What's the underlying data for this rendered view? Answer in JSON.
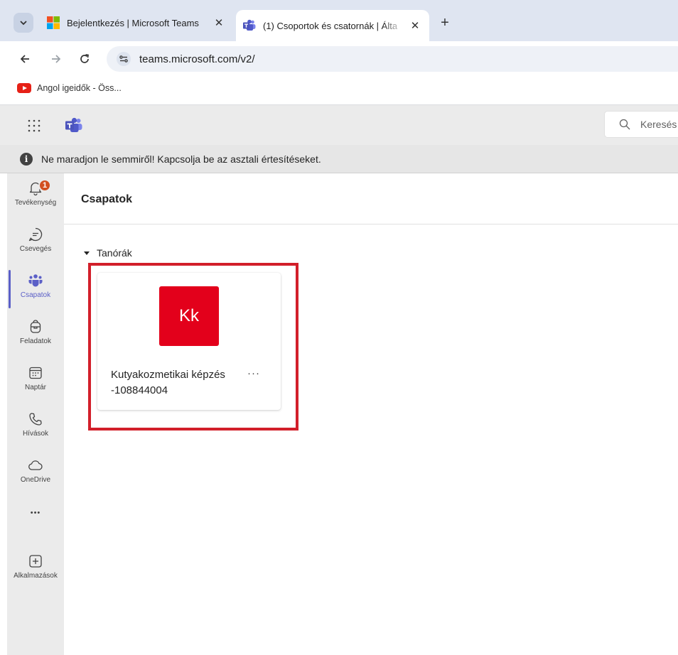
{
  "browser": {
    "tabs": [
      {
        "title": "Bejelentkezés | Microsoft Teams",
        "icon": "microsoft-logo-icon",
        "active": false
      },
      {
        "title": "(1) Csoportok és csatornák | Álta",
        "icon": "teams-icon",
        "active": true
      }
    ],
    "close_glyph": "✕",
    "new_tab_glyph": "+",
    "url": "teams.microsoft.com/v2/",
    "bookmarks": [
      {
        "label": "Angol igeidők - Öss...",
        "icon": "youtube-icon"
      }
    ]
  },
  "teams": {
    "search_placeholder": "Keresés",
    "notification": "Ne maradjon le semmiről! Kapcsolja be az asztali értesítéseket.",
    "rail": [
      {
        "label": "Tevékenység",
        "icon": "bell-icon",
        "badge": "1"
      },
      {
        "label": "Csevegés",
        "icon": "chat-icon"
      },
      {
        "label": "Csapatok",
        "icon": "teams-people-icon",
        "active": true
      },
      {
        "label": "Feladatok",
        "icon": "backpack-icon"
      },
      {
        "label": "Naptár",
        "icon": "calendar-icon"
      },
      {
        "label": "Hívások",
        "icon": "phone-icon"
      },
      {
        "label": "OneDrive",
        "icon": "cloud-icon"
      },
      {
        "label": "•••",
        "icon": "more-icon"
      },
      {
        "label": "Alkalmazások",
        "icon": "add-app-icon"
      }
    ],
    "page_title": "Csapatok",
    "group": {
      "name": "Tanórák",
      "teams": [
        {
          "initials": "Kk",
          "name": "Kutyakozmetikai képzés -108844004",
          "avatar_color": "#e3001b"
        }
      ]
    },
    "more_glyph": "···"
  },
  "colors": {
    "accent": "#5b5fc7",
    "highlight_border": "#d21f2a",
    "badge": "#d24f1f"
  }
}
